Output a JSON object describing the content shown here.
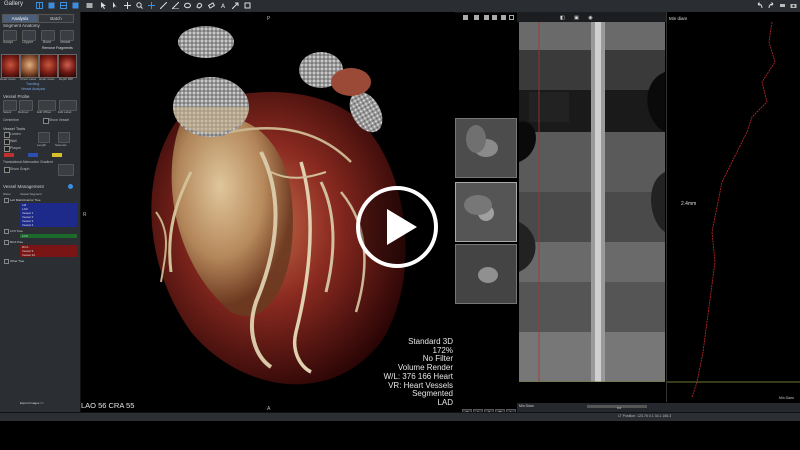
{
  "topbar": {
    "gallery_label": "Gallery"
  },
  "left_panel": {
    "tabs": [
      "Analysis",
      "Batch"
    ],
    "segment_anatomy": "Segment Anatomy",
    "tools": [
      "Sculpt",
      "Clipper",
      "Bone",
      "Vessel"
    ],
    "remove_fragments": "Remove Fragments",
    "thumbnails": [
      "Heart views",
      "Chest views",
      "Heart views",
      "Depth MIP"
    ],
    "tracking": "Tracking",
    "vessel_analysis": "Vessel Analysis",
    "vessel_probe": "Vessel Probe",
    "probe_tools": [
      "Select",
      "Refined",
      "Edit Offset",
      "Edit Label"
    ],
    "centerline": "Centerline",
    "show_vessel": "Show Vessel",
    "vessel_tools_label": "Vessel Tools",
    "lumen": "Lumen",
    "wall": "Wall",
    "plaque": "Plaque",
    "length": "Length",
    "stenosis": "Stenosis",
    "translational_attenuation_gradient": "Translational Attenuation Gradient",
    "show_graph": "Show Graph",
    "vessel_management": "Vessel Management",
    "vessel_table_cols": [
      "Show",
      "Vessel Segment"
    ],
    "vessel_groups": [
      {
        "name": "Left Main/Anterior Tree",
        "color": "#1e2a8a",
        "items": [
          "LM",
          "LAD",
          "Vessel 1",
          "Vessel 2",
          "Vessel 3",
          "Vessel 4"
        ]
      },
      {
        "name": "LCX Tree",
        "color": "#1d6b2a",
        "items": [
          "LCX"
        ]
      },
      {
        "name": "RCA Tree",
        "color": "#7a1515",
        "items": [
          "RCA",
          "Vessel 9",
          "Vessel 10"
        ]
      },
      {
        "name": "Other Tree",
        "color": "#444444",
        "items": []
      }
    ],
    "export_images": "Export Images >>"
  },
  "viewport": {
    "orientation": {
      "top": "P",
      "left": "R",
      "bottom": "A",
      "right": "L"
    },
    "angle": "LAO 56  CRA 55",
    "overlay": [
      "Standard 3D",
      "172%",
      "No Filter",
      "Volume Render",
      "W/L: 376 166 Heart",
      "VR: Heart Vessels",
      "Segmented",
      "LAD"
    ],
    "view_tools": [
      "S",
      "I",
      "A",
      "P",
      "L",
      "R",
      "O"
    ]
  },
  "right": {
    "min_diam_title": "Min diam",
    "measurement": "2.4mm",
    "min_diam_footer": "Min Diam",
    "bottom_left": "Min Diam",
    "status": "LT Position: 123.76 0.1   34.1   166.3",
    "slider_value": "0.0"
  },
  "player": {
    "icon": "play-icon"
  }
}
